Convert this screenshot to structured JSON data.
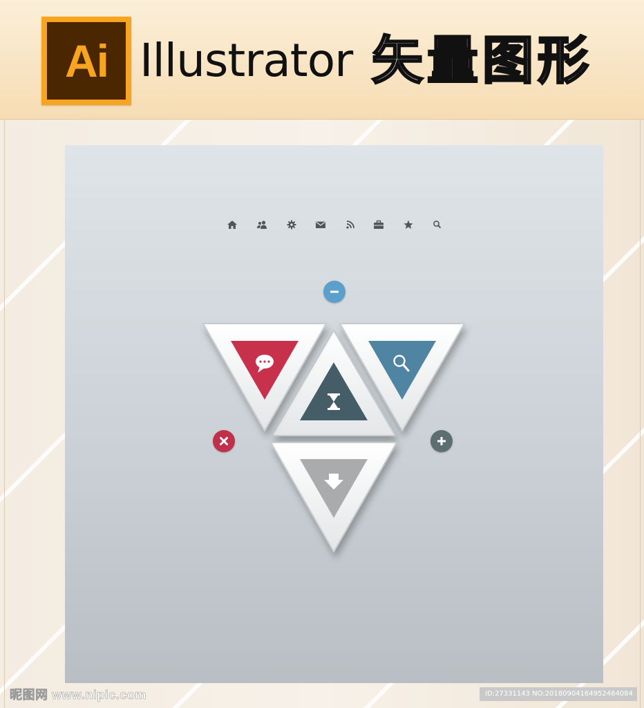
{
  "header": {
    "logo_text": "Ai",
    "app_name": "Illustrator",
    "subtitle": "矢量图形"
  },
  "toolbar": {
    "icons": [
      "home-icon",
      "users-icon",
      "gear-icon",
      "mail-icon",
      "rss-icon",
      "briefcase-icon",
      "star-icon",
      "search-icon"
    ]
  },
  "controls": {
    "minus_color": "#5b9fcd",
    "close_color": "#c0304a",
    "plus_color": "#5d6e72"
  },
  "triangles": [
    {
      "name": "chat-triangle",
      "color": "#c8314b",
      "icon": "chat-bubble-icon"
    },
    {
      "name": "search-triangle",
      "color": "#4f84a2",
      "icon": "magnifier-icon"
    },
    {
      "name": "hourglass-triangle",
      "color": "#445d66",
      "icon": "hourglass-icon"
    },
    {
      "name": "download-triangle",
      "color": "#a9abac",
      "icon": "download-arrow-icon"
    }
  ],
  "footer": {
    "site": "昵图网 www.nipic.com",
    "id_text": "ID:27331143 NO:20180904164952464084"
  }
}
